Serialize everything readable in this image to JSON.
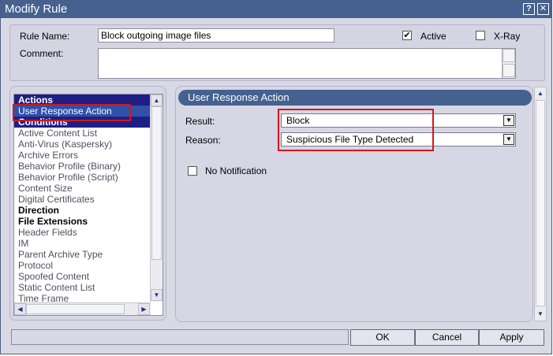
{
  "window": {
    "title": "Modify Rule",
    "help_glyph": "?",
    "close_glyph": "✕"
  },
  "header": {
    "rule_name_label": "Rule Name:",
    "rule_name_value": "Block outgoing image files",
    "comment_label": "Comment:",
    "comment_value": "",
    "active_label": "Active",
    "active_checked": true,
    "xray_label": "X-Ray",
    "xray_checked": false
  },
  "rule_list": {
    "items": [
      {
        "label": "Actions",
        "kind": "header"
      },
      {
        "label": "User Response Action",
        "kind": "selected"
      },
      {
        "label": "Conditions",
        "kind": "header"
      },
      {
        "label": "Active Content List",
        "kind": "normal"
      },
      {
        "label": "Anti-Virus (Kaspersky)",
        "kind": "normal"
      },
      {
        "label": "Archive Errors",
        "kind": "normal"
      },
      {
        "label": "Behavior Profile (Binary)",
        "kind": "normal"
      },
      {
        "label": "Behavior Profile (Script)",
        "kind": "normal"
      },
      {
        "label": "Content Size",
        "kind": "normal"
      },
      {
        "label": "Digital Certificates",
        "kind": "normal"
      },
      {
        "label": "Direction",
        "kind": "bold"
      },
      {
        "label": "File Extensions",
        "kind": "bold"
      },
      {
        "label": "Header Fields",
        "kind": "normal"
      },
      {
        "label": "IM",
        "kind": "normal"
      },
      {
        "label": "Parent Archive Type",
        "kind": "normal"
      },
      {
        "label": "Protocol",
        "kind": "normal"
      },
      {
        "label": "Spoofed Content",
        "kind": "normal"
      },
      {
        "label": "Static Content List",
        "kind": "normal"
      },
      {
        "label": "Time Frame",
        "kind": "normal"
      }
    ]
  },
  "detail": {
    "section_title": "User Response Action",
    "result_label": "Result:",
    "result_value": "Block",
    "reason_label": "Reason:",
    "reason_value": "Suspicious File Type Detected",
    "no_notification_label": "No Notification",
    "no_notification_checked": false
  },
  "footer": {
    "status_text": "",
    "ok_label": "OK",
    "cancel_label": "Cancel",
    "apply_label": "Apply"
  },
  "colors": {
    "title_bar": "#44618f",
    "list_header": "#1e1f85",
    "list_selected": "#2f51a8",
    "highlight_box": "#d2171e"
  },
  "icons": {
    "scroll_up": "▲",
    "scroll_down": "▼",
    "scroll_left": "◀",
    "scroll_right": "▶",
    "dropdown": "▼",
    "check": "✔"
  }
}
